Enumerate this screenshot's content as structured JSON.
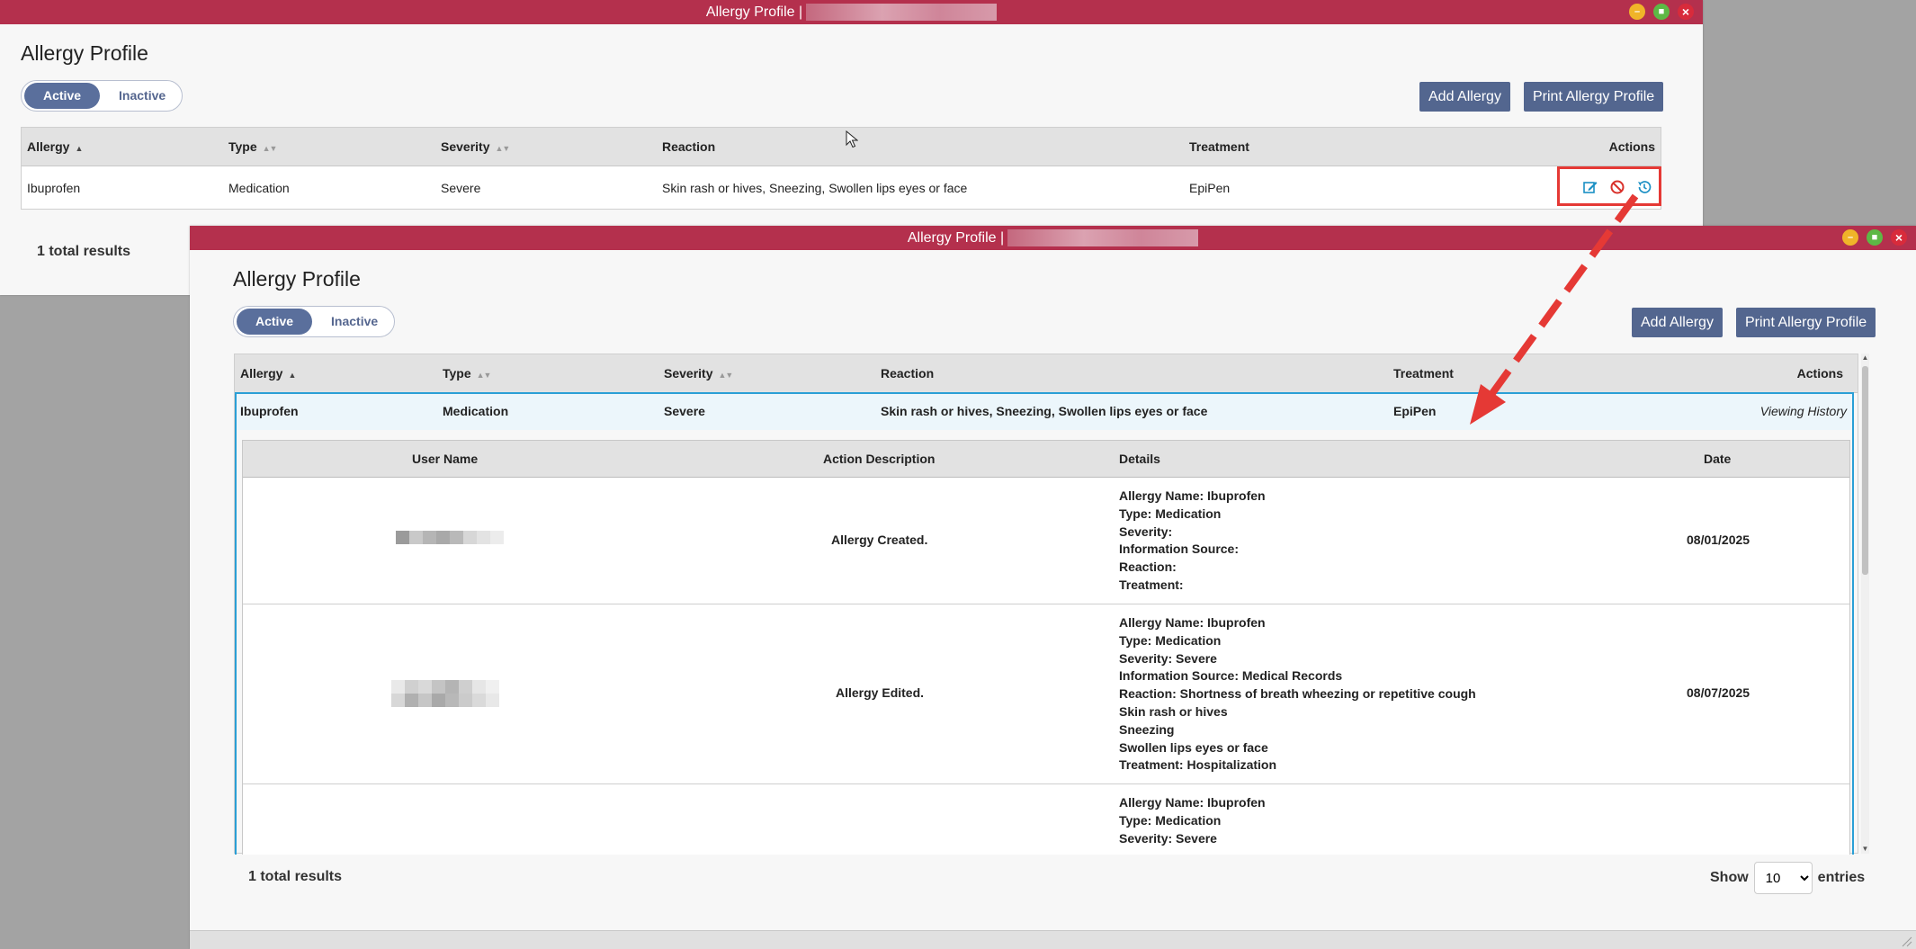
{
  "back_window": {
    "title": "Allergy Profile |",
    "heading": "Allergy Profile",
    "tabs": {
      "active": "Active",
      "inactive": "Inactive"
    },
    "buttons": {
      "add": "Add Allergy",
      "print": "Print Allergy Profile"
    },
    "columns": {
      "allergy": "Allergy",
      "type": "Type",
      "severity": "Severity",
      "reaction": "Reaction",
      "treatment": "Treatment",
      "actions": "Actions"
    },
    "row": {
      "allergy": "Ibuprofen",
      "type": "Medication",
      "severity": "Severe",
      "reaction": "Skin rash or hives, Sneezing, Swollen lips eyes or face",
      "treatment": "EpiPen"
    },
    "total": "1 total results"
  },
  "front_window": {
    "title": "Allergy Profile |",
    "heading": "Allergy Profile",
    "tabs": {
      "active": "Active",
      "inactive": "Inactive"
    },
    "buttons": {
      "add": "Add Allergy",
      "print": "Print Allergy Profile"
    },
    "columns": {
      "allergy": "Allergy",
      "type": "Type",
      "severity": "Severity",
      "reaction": "Reaction",
      "treatment": "Treatment",
      "actions": "Actions"
    },
    "row": {
      "allergy": "Ibuprofen",
      "type": "Medication",
      "severity": "Severe",
      "reaction": "Skin rash or hives, Sneezing, Swollen lips eyes or face",
      "treatment": "EpiPen",
      "status": "Viewing History"
    },
    "history": {
      "columns": {
        "user": "User Name",
        "action": "Action Description",
        "details": "Details",
        "date": "Date"
      },
      "rows": [
        {
          "action": "Allergy Created.",
          "date": "08/01/2025",
          "details": {
            "l1": "Allergy Name: Ibuprofen",
            "l2": "Type: Medication",
            "l3": "Severity:",
            "l4": "Information Source:",
            "l5": "Reaction:",
            "l6": "Treatment:"
          }
        },
        {
          "action": "Allergy Edited.",
          "date": "08/07/2025",
          "details": {
            "l1": "Allergy Name: Ibuprofen",
            "l2": "Type: Medication",
            "l3": "Severity: Severe",
            "l4": "Information Source: Medical Records",
            "l5": "Reaction: Shortness of breath wheezing or repetitive cough",
            "l6": "Skin rash or hives",
            "l7": "Sneezing",
            "l8": "Swollen lips eyes or face",
            "l9": "Treatment: Hospitalization"
          }
        },
        {
          "details": {
            "l1": "Allergy Name: Ibuprofen",
            "l2": "Type: Medication",
            "l3": "Severity: Severe"
          }
        }
      ]
    },
    "total": "1 total results",
    "show_label": "Show",
    "entries_value": "10",
    "entries_label": "entries"
  },
  "icons": {
    "edit": "edit-icon",
    "deactivate": "ban-icon",
    "history": "history-icon",
    "minimize": "minimize-icon",
    "maximize": "maximize-icon",
    "close": "close-icon",
    "cursor": "mouse-cursor-icon"
  },
  "colors": {
    "titlebar": "#b4304d",
    "button": "#53668f",
    "highlight": "#e53935",
    "selection_border": "#2a9fd6",
    "icon_teal": "#1a8fc4"
  }
}
